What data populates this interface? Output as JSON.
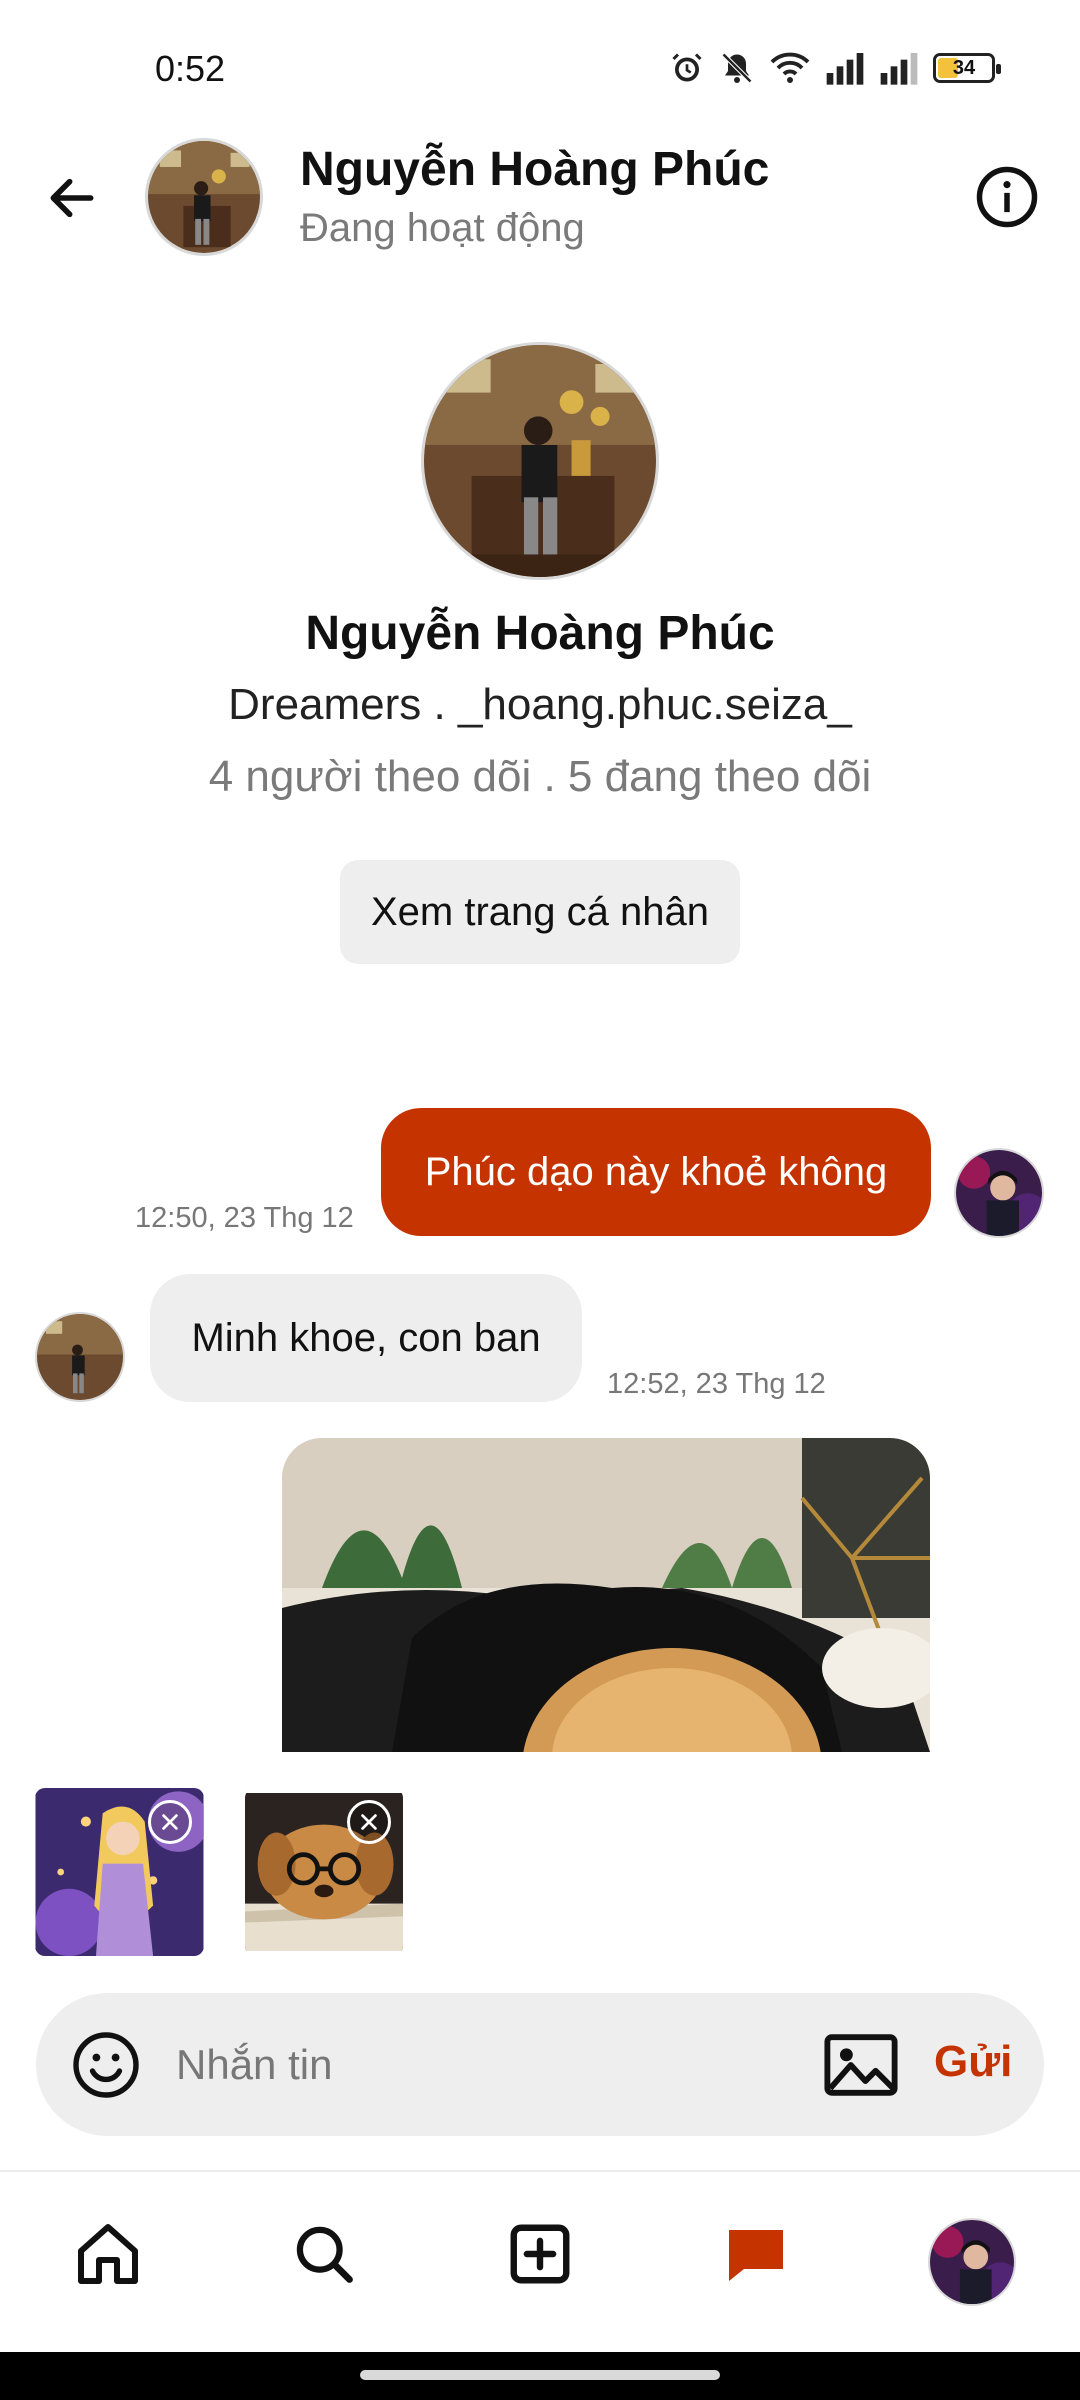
{
  "status_bar": {
    "time": "0:52",
    "battery": "34",
    "icons": [
      "alarm-icon",
      "mute-icon",
      "wifi-icon",
      "signal-icon",
      "signal-icon",
      "battery-icon"
    ]
  },
  "header": {
    "name": "Nguyễn Hoàng Phúc",
    "status": "Đang hoạt động",
    "back_icon": "back-arrow-icon",
    "info_icon": "info-icon"
  },
  "profile": {
    "name": "Nguyễn Hoàng Phúc",
    "bio": "Dreamers . _hoang.phuc.seiza_",
    "follow_stats": "4 người theo dõi . 5 đang theo dõi",
    "view_profile_label": "Xem trang cá nhân"
  },
  "messages": [
    {
      "direction": "out",
      "text": "Phúc dạo này khoẻ không",
      "time": "12:50, 23 Thg 12"
    },
    {
      "direction": "in",
      "text": "Minh khoe, con ban",
      "time": "12:52, 23 Thg 12"
    },
    {
      "direction": "in",
      "type": "image",
      "alt": "dog photo"
    }
  ],
  "attachments": [
    {
      "name": "attachment-princess"
    },
    {
      "name": "attachment-dog-glasses"
    }
  ],
  "composer": {
    "placeholder": "Nhắn tin",
    "send_label": "Gửi"
  },
  "nav": {
    "items": [
      "home-icon",
      "search-icon",
      "create-icon",
      "messages-icon",
      "profile-avatar"
    ],
    "active": "messages-icon"
  },
  "colors": {
    "accent": "#c53300",
    "bubble_in": "#eeeeee",
    "muted_text": "#777777"
  }
}
